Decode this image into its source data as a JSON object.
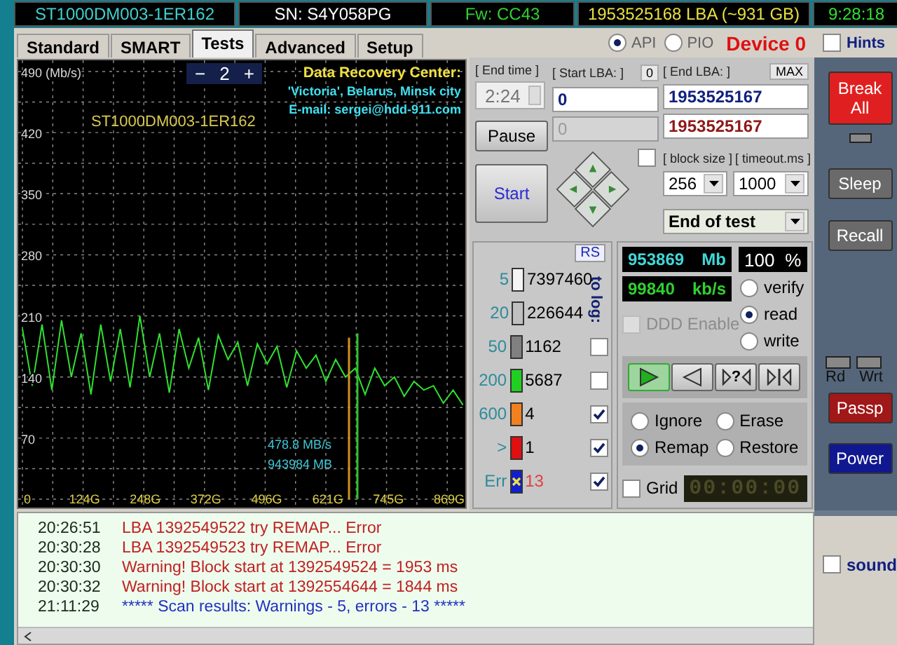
{
  "status_bar": [
    {
      "text": "ST1000DM003-1ER162",
      "kind": "model"
    },
    {
      "text": "SN: S4Y058PG",
      "kind": "serial"
    },
    {
      "text": "Fw: CC43",
      "kind": "firmware"
    },
    {
      "text": "1953525168 LBA (~931 GB)",
      "kind": "capacity"
    },
    {
      "text": "9:28:18",
      "kind": "clock"
    }
  ],
  "tabs": [
    {
      "label": "Standard",
      "selected": false
    },
    {
      "label": "SMART",
      "selected": false
    },
    {
      "label": "Tests",
      "selected": true
    },
    {
      "label": "Advanced",
      "selected": false
    },
    {
      "label": "Setup",
      "selected": false
    }
  ],
  "interface": [
    {
      "label": "API",
      "selected": true
    },
    {
      "label": "PIO",
      "selected": false
    }
  ],
  "device": "Device 0",
  "graph": {
    "chart_data": {
      "type": "line",
      "grid": true,
      "xlim": [
        0,
        900
      ],
      "ylim": [
        0,
        490
      ],
      "x": [
        0,
        20,
        40,
        60,
        80,
        100,
        120,
        140,
        160,
        180,
        200,
        220,
        240,
        260,
        280,
        300,
        320,
        340,
        360,
        380,
        400,
        420,
        440,
        460,
        480,
        500,
        520,
        540,
        560,
        580,
        600,
        620,
        640,
        660,
        680,
        700,
        720,
        740,
        760,
        780,
        800,
        820,
        840,
        860,
        880,
        900
      ],
      "series": [
        {
          "color": "#30e030",
          "values": [
            195,
            130,
            200,
            125,
            205,
            140,
            190,
            120,
            200,
            135,
            195,
            128,
            210,
            140,
            190,
            122,
            195,
            150,
            185,
            125,
            188,
            160,
            180,
            130,
            178,
            155,
            175,
            128,
            170,
            150,
            165,
            135,
            160,
            140,
            150,
            120,
            150,
            130,
            140,
            118,
            135,
            125,
            130,
            110,
            125,
            108
          ]
        }
      ],
      "yticks": [
        {
          "value": 490,
          "label": "490 (Mb/s)"
        },
        {
          "value": 420,
          "label": "420"
        },
        {
          "value": 350,
          "label": "350"
        },
        {
          "value": 280,
          "label": "280"
        },
        {
          "value": 210,
          "label": "210"
        },
        {
          "value": 140,
          "label": "140"
        },
        {
          "value": 70,
          "label": "70"
        }
      ],
      "xticks": [
        {
          "value": 0,
          "label": "0"
        },
        {
          "value": 124,
          "label": "124G"
        },
        {
          "value": 248,
          "label": "248G"
        },
        {
          "value": 372,
          "label": "372G"
        },
        {
          "value": 496,
          "label": "496G"
        },
        {
          "value": 621,
          "label": "621G"
        },
        {
          "value": 745,
          "label": "745G"
        },
        {
          "value": 869,
          "label": "869G"
        }
      ]
    },
    "zoom": {
      "minus": "−",
      "value": "2",
      "plus": "+"
    },
    "drive_model": "ST1000DM003-1ER162",
    "credits": [
      "Data Recovery Center:",
      "'Victoria', Belarus, Minsk city",
      "E-mail: sergei@hdd-911.com"
    ],
    "speed": "478.8 MB/s",
    "position": "943984 MB"
  },
  "range": {
    "end_time_label": "[ End time ]",
    "end_time": "2:24",
    "start_lba_label": "[ Start LBA: ]",
    "start_reset": "0",
    "start_lba": "0",
    "current_lba": "0",
    "end_lba_label": "[ End LBA: ]",
    "max_button": "MAX",
    "end_lba": "1953525167",
    "end_lba_current": "1953525167",
    "pause": "Pause",
    "start": "Start",
    "nav_checked": false,
    "block_size_label": "[ block size ]",
    "block_size": "256",
    "timeout_label": "[ timeout.ms ]",
    "timeout": "1000",
    "end_action": "End of test"
  },
  "histogram": {
    "reset": "RS",
    "log_label": "to log:",
    "rows": [
      {
        "label": "5",
        "count": "7397460",
        "color": "#f4f4f4",
        "kind": "plain"
      },
      {
        "label": "20",
        "count": "226644",
        "color": "#c0c0c0",
        "kind": "plain"
      },
      {
        "label": "50",
        "count": "1162",
        "color": "#808080",
        "kind": "logged",
        "checked": false
      },
      {
        "label": "200",
        "count": "5687",
        "color": "#20d020",
        "kind": "logged",
        "checked": false
      },
      {
        "label": "600",
        "count": "4",
        "color": "#f08020",
        "kind": "logged",
        "checked": true
      },
      {
        "label": ">",
        "count": "1",
        "color": "#e01010",
        "kind": "logged",
        "checked": true
      },
      {
        "label": "Err",
        "count": "13",
        "color": "#1020d0",
        "kind": "error",
        "checked": true
      }
    ]
  },
  "stats": {
    "scanned": "953869",
    "scanned_unit": "Mb",
    "percent": "100",
    "percent_unit": "%",
    "speed": "99840",
    "speed_unit": "kb/s",
    "ddd": {
      "label": "DDD Enable",
      "checked": false,
      "disabled": true
    },
    "modes": [
      {
        "label": "verify",
        "selected": false
      },
      {
        "label": "read",
        "selected": true
      },
      {
        "label": "write",
        "selected": false
      }
    ],
    "transport": [
      {
        "kind": "play",
        "selected": true
      },
      {
        "kind": "reverse",
        "selected": false
      },
      {
        "kind": "seek",
        "label": "?",
        "selected": false
      },
      {
        "kind": "end",
        "selected": false
      }
    ],
    "actions": [
      {
        "label": "Ignore",
        "selected": false
      },
      {
        "label": "Erase",
        "selected": false
      },
      {
        "label": "Remap",
        "selected": true
      },
      {
        "label": "Restore",
        "selected": false
      }
    ],
    "grid": {
      "label": "Grid",
      "checked": false
    },
    "timer": "00:00:00"
  },
  "side": {
    "hints": {
      "label": "Hints",
      "checked": false
    },
    "break_all": "Break All",
    "sleep": "Sleep",
    "recall": "Recall",
    "rd": "Rd",
    "wrt": "Wrt",
    "passp": "Passp",
    "power": "Power",
    "sound": {
      "label": "sound",
      "checked": false
    }
  },
  "log": [
    {
      "time": "20:26:51",
      "text": "LBA 1392549522 try REMAP... Error",
      "kind": "error"
    },
    {
      "time": "20:30:28",
      "text": "LBA 1392549523 try REMAP... Error",
      "kind": "error"
    },
    {
      "time": "20:30:30",
      "text": "Warning! Block start at 1392549524 = 1953 ms",
      "kind": "warning"
    },
    {
      "time": "20:30:32",
      "text": "Warning! Block start at 1392554644 = 1844 ms",
      "kind": "warning"
    },
    {
      "time": "21:11:29",
      "text": "***** Scan results: Warnings - 5, errors - 13 *****",
      "kind": "result"
    }
  ]
}
